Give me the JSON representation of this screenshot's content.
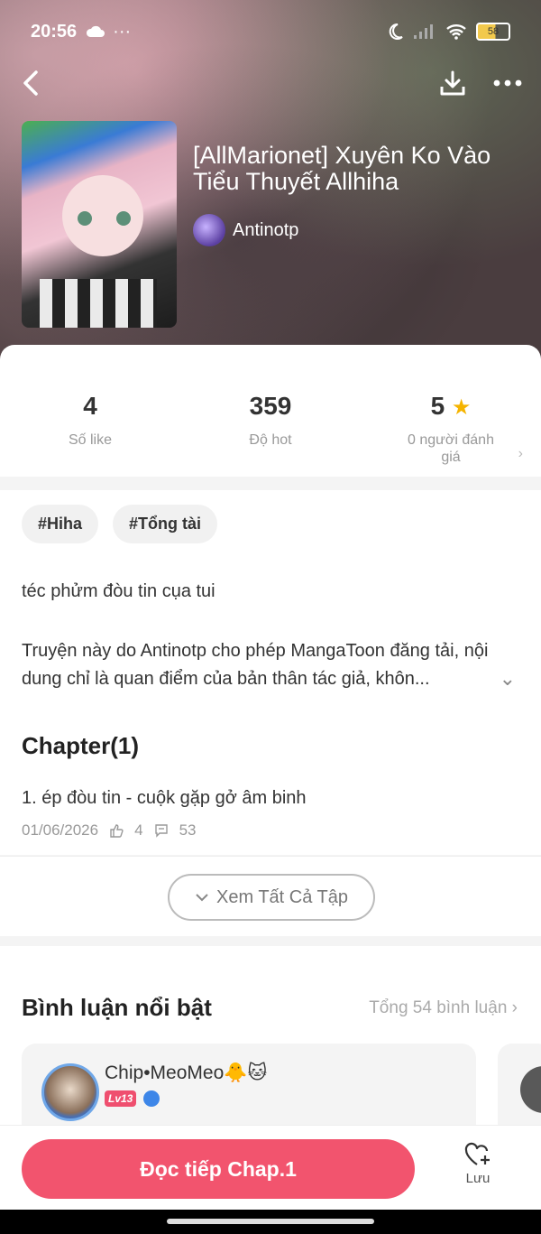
{
  "status_bar": {
    "time": "20:56",
    "battery": "58"
  },
  "book": {
    "title": "[AllMarionet] Xuyên Ko Vào Tiểu Thuyết Allhiha",
    "author": "Antinotp"
  },
  "stats": [
    {
      "value": "4",
      "label": "Số like"
    },
    {
      "value": "359",
      "label": "Độ hot"
    },
    {
      "value": "5",
      "label": "0 người đánh giá"
    }
  ],
  "tags": [
    "#Hiha",
    "#Tổng tài"
  ],
  "description": {
    "line1": "téc phửm đòu tin cụa tui",
    "line2": "Truyện này do Antinotp cho phép MangaToon đăng tải, nội dung chỉ là quan điểm của bản thân tác giả, khôn..."
  },
  "chapters": {
    "heading": "Chapter(1)",
    "items": [
      {
        "title": "1. ép đòu tin - cuộk gặp gở âm binh",
        "date": "01/06/2026",
        "likes": "4",
        "comments": "53"
      }
    ],
    "view_all": "Xem Tất Cả Tập"
  },
  "comments": {
    "heading": "Bình luận nổi bật",
    "total": "Tổng 54 bình luận",
    "items": [
      {
        "name": "Chip•MeoMeo🐥🐱",
        "level": "Lv13"
      }
    ]
  },
  "bottom": {
    "read_label": "Đọc tiếp Chap.1",
    "save_label": "Lưu"
  },
  "colors": {
    "accent": "#f2546e",
    "star": "#f5b400"
  }
}
